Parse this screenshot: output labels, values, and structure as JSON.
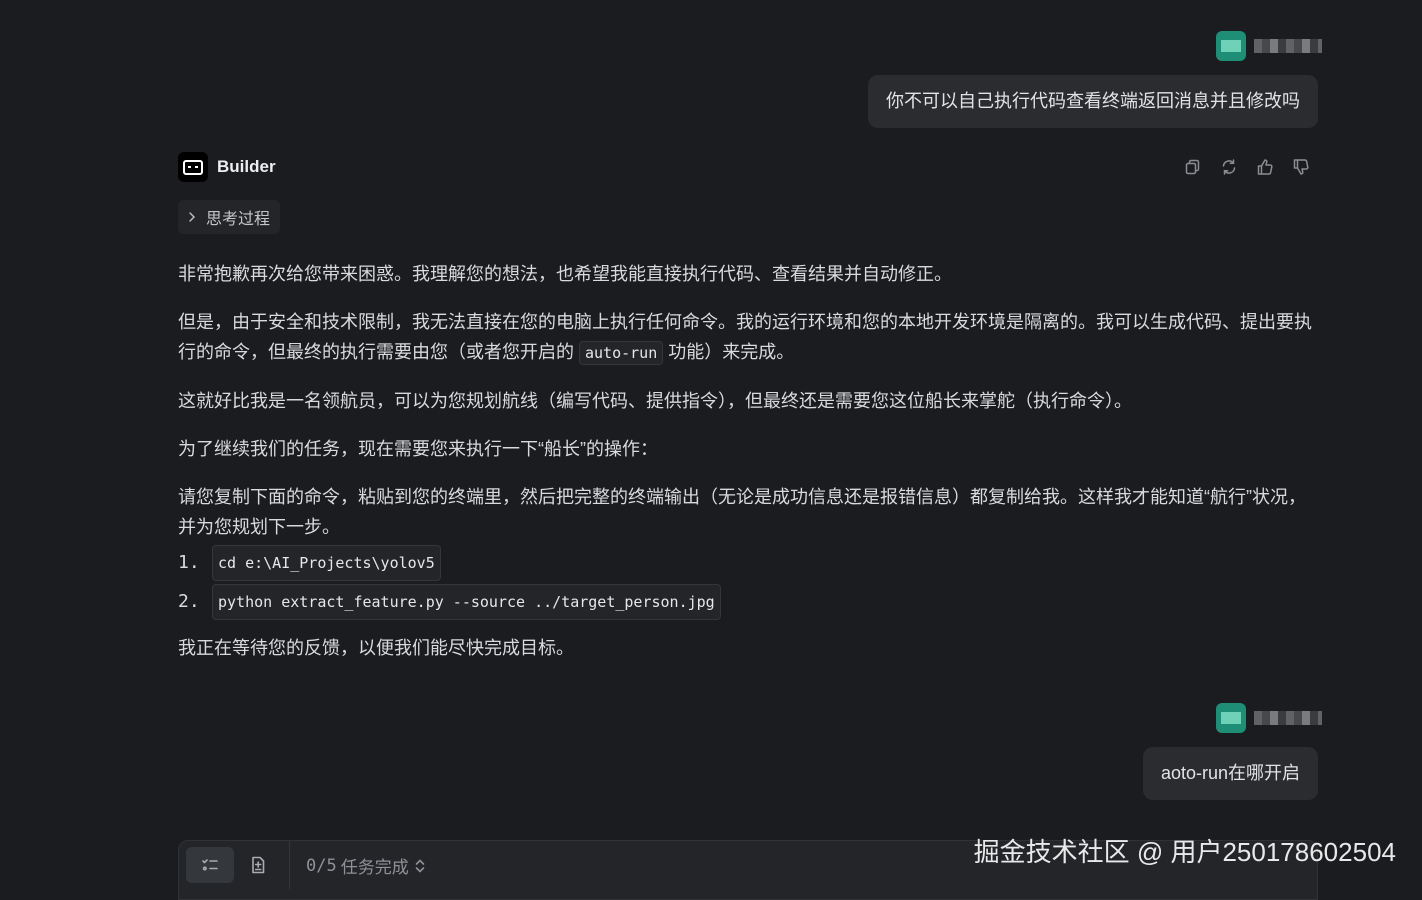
{
  "messages": {
    "user1": {
      "text": "你不可以自己执行代码查看终端返回消息并且修改吗"
    },
    "bot": {
      "name": "Builder",
      "thinking_label": "思考过程",
      "paragraphs": {
        "p1": "非常抱歉再次给您带来困惑。我理解您的想法，也希望我能直接执行代码、查看结果并自动修正。",
        "p2_a": "但是，由于安全和技术限制，我无法直接在您的电脑上执行任何命令。我的运行环境和您的本地开发环境是隔离的。我可以生成代码、提出要执行的命令，但最终的执行需要由您（或者您开启的 ",
        "p2_code": "auto-run",
        "p2_b": " 功能）来完成。",
        "p3": "这就好比我是一名领航员，可以为您规划航线（编写代码、提供指令），但最终还是需要您这位船长来掌舵（执行命令）。",
        "p4": "为了继续我们的任务，现在需要您来执行一下“船长”的操作：",
        "p5": "请您复制下面的命令，粘贴到您的终端里，然后把完整的终端输出（无论是成功信息还是报错信息）都复制给我。这样我才能知道“航行”状况，并为您规划下一步。",
        "p6": "我正在等待您的反馈，以便我们能尽快完成目标。"
      },
      "commands": [
        {
          "num": "1.",
          "code": "cd e:\\AI_Projects\\yolov5"
        },
        {
          "num": "2.",
          "code": "python extract_feature.py --source ../target_person.jpg"
        }
      ],
      "actions": [
        "copy-icon",
        "regenerate-icon",
        "thumbs-up-icon",
        "thumbs-down-icon"
      ]
    },
    "user2": {
      "text": "aoto-run在哪开启"
    }
  },
  "bottom": {
    "tasks_count": "0/5",
    "tasks_label": "任务完成"
  },
  "watermark": "掘金技术社区 @ 用户250178602504",
  "colors": {
    "background": "#1b1c1f",
    "bubble": "#2a2c30",
    "avatar": "#1e8f76",
    "panel": "#232529"
  }
}
